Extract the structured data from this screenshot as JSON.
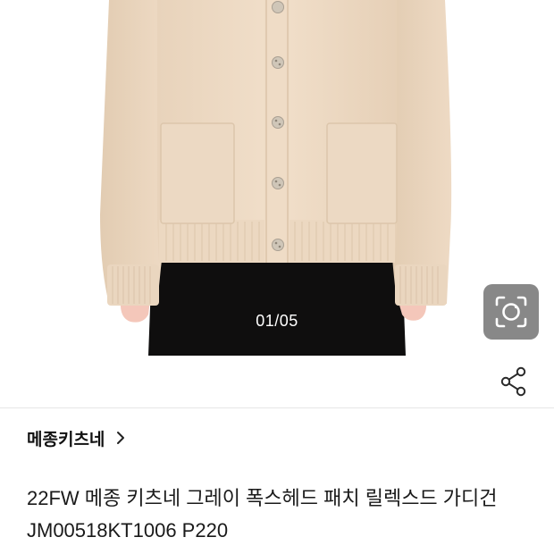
{
  "gallery": {
    "page_indicator": "01/05",
    "current_index": 1,
    "total_images": 5,
    "lens_icon": "camera-lens-icon",
    "colors": {
      "cardigan": "#efdcc6",
      "pants": "#0e0d0d",
      "buttons": "#c9c0b2"
    }
  },
  "share": {
    "icon": "share-icon"
  },
  "brand": {
    "name": "메종키츠네",
    "chevron_icon": "chevron-right-icon"
  },
  "product": {
    "title": "22FW 메종 키츠네 그레이 폭스헤드 패치 릴렉스드 가디건 JM00518KT1006 P220"
  }
}
